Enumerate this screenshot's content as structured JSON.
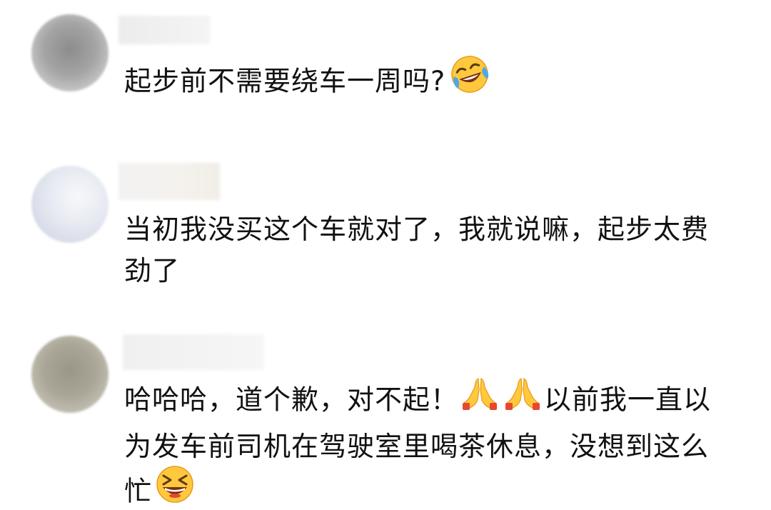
{
  "comments": [
    {
      "text_parts": [
        "起步前不需要绕车一周吗?",
        ""
      ],
      "emojis": [
        "laughing-crying-emoji"
      ]
    },
    {
      "text": "当初我没买这个车就对了，我就说嘛，起步太费劲了"
    },
    {
      "text_parts": [
        "哈哈哈，道个歉，对不起！",
        "以前我一直以为发车前司机在驾驶室里喝茶休息，没想到这么忙"
      ],
      "emojis": [
        "folded-hands-emoji",
        "folded-hands-emoji",
        "grinning-squinting-emoji"
      ]
    }
  ],
  "colors": {
    "text": "#111111",
    "background": "#ffffff"
  }
}
